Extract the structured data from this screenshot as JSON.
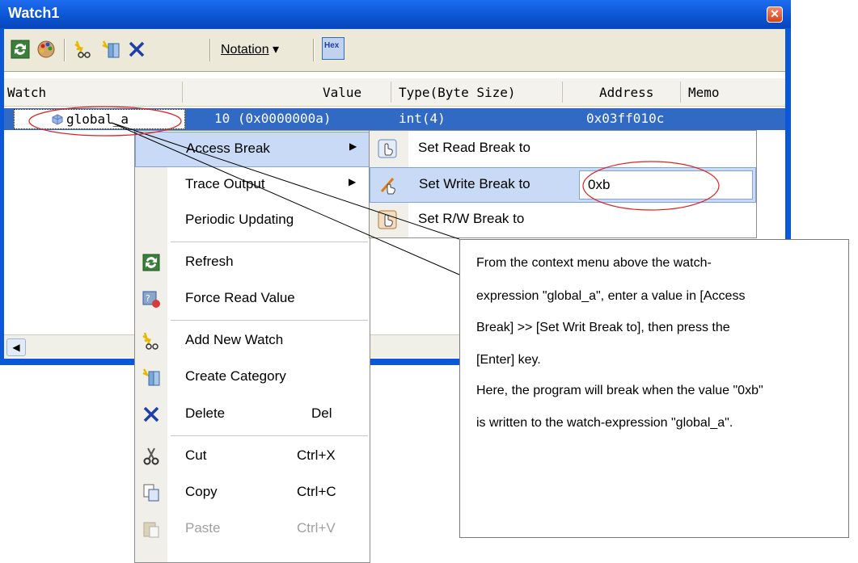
{
  "window": {
    "title": "Watch1",
    "close_glyph": "✕"
  },
  "toolbar": {
    "notation_label": "Notation",
    "notation_arrow": "▾",
    "hex_label": "Hex"
  },
  "columns": {
    "watch": "Watch",
    "value": "Value",
    "type": "Type(Byte Size)",
    "address": "Address",
    "memo": "Memo"
  },
  "row": {
    "name": "global_a",
    "value": "10 (0x0000000a)",
    "type": "int(4)",
    "address": "0x03ff010c"
  },
  "menu": {
    "access_break": "Access Break",
    "trace_output": "Trace Output",
    "periodic_updating": "Periodic Updating",
    "refresh": "Refresh",
    "force_read_value": "Force Read Value",
    "add_new_watch": "Add New Watch",
    "create_category": "Create Category",
    "delete": "Delete",
    "delete_shortcut": "Del",
    "cut": "Cut",
    "cut_shortcut": "Ctrl+X",
    "copy": "Copy",
    "copy_shortcut": "Ctrl+C",
    "paste": "Paste",
    "paste_shortcut": "Ctrl+V"
  },
  "submenu": {
    "set_read_break": "Set Read Break to",
    "set_write_break": "Set Write Break to",
    "set_rw_break": "Set R/W Break to",
    "write_value": "0xb"
  },
  "callout": {
    "line1": "From the context menu above the watch-",
    "line2": "expression \"global_a\", enter a value in [Access",
    "line3": "Break] >> [Set Writ Break to], then press the",
    "line4": "[Enter] key.",
    "line5": "Here, the program will break when the value \"0xb\"",
    "line6": "is written to the watch-expression \"global_a\"."
  },
  "icons": [
    "refresh-icon",
    "color-icon",
    "add-watch-icon",
    "create-category-icon",
    "delete-icon",
    "hex-icon",
    "read-break-icon",
    "write-break-icon",
    "rw-break-icon",
    "force-read-icon",
    "cut-icon",
    "copy-icon",
    "paste-icon",
    "variable-icon",
    "submenu-arrow-icon",
    "scroll-left-icon"
  ],
  "colors": {
    "titlebar": "#0a58d8",
    "selection": "#316ac5",
    "menu_highlight": "#c8daf5",
    "annotation_red": "#e02020"
  }
}
